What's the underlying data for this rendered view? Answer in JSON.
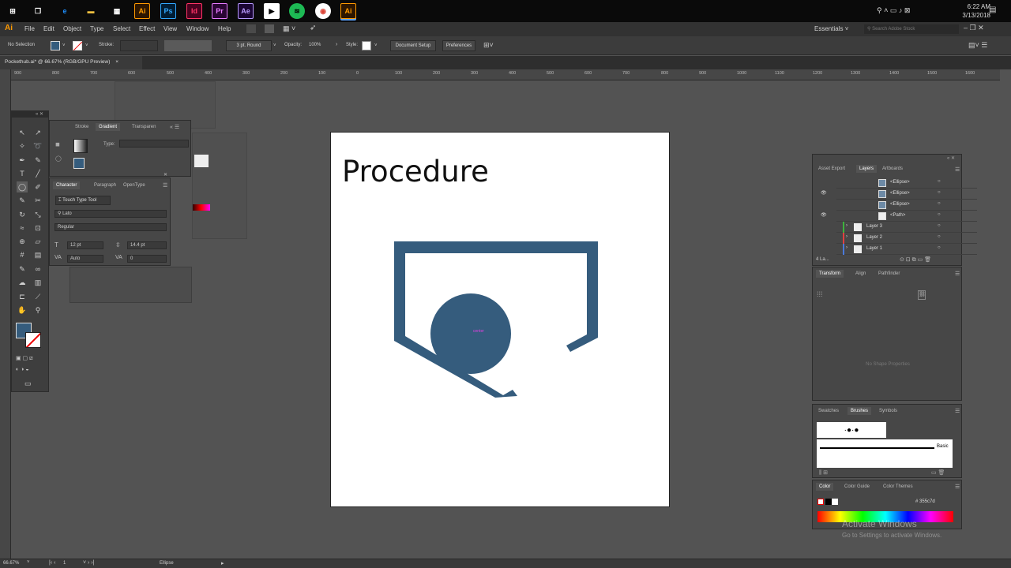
{
  "taskbar": {
    "apps": [
      "Ai",
      "Ps",
      "Id",
      "Pr",
      "Ae",
      "Ai"
    ],
    "time": "6:22 AM",
    "date": "3/13/2018"
  },
  "menu": {
    "logo": "Ai",
    "items": [
      "File",
      "Edit",
      "Object",
      "Type",
      "Select",
      "Effect",
      "View",
      "Window",
      "Help"
    ],
    "workspace": "Essentials",
    "search_placeholder": "Search Adobe Stock"
  },
  "control": {
    "selection": "No Selection",
    "stroke_label": "Stroke:",
    "brush": "3 pt. Round",
    "opacity_label": "Opacity:",
    "opacity_value": "100%",
    "style_label": "Style:",
    "doc_setup": "Document Setup",
    "preferences": "Preferences"
  },
  "document": {
    "tab_title": "Pockethub.ai* @ 66.67% (RGB/GPU Preview)",
    "tab_close": "×"
  },
  "ruler": {
    "labels": [
      "900",
      "800",
      "700",
      "600",
      "500",
      "400",
      "300",
      "200",
      "100",
      "0",
      "100",
      "200",
      "300",
      "400",
      "500",
      "600",
      "700",
      "800",
      "900",
      "1000",
      "1100",
      "1200",
      "1300",
      "1400",
      "1500",
      "1600"
    ]
  },
  "artboard": {
    "title": "Procedure",
    "center_label": "center",
    "fill_color": "#355c7d"
  },
  "gradient_panel": {
    "tabs": [
      "Stroke",
      "Gradient",
      "Transparen"
    ],
    "type_label": "Type:"
  },
  "character_panel": {
    "tabs": [
      "Character",
      "Paragraph",
      "OpenType"
    ],
    "tool_label": "Touch Type Tool",
    "font_family": "Lato",
    "font_style": "Regular",
    "font_size": "12 pt",
    "leading": "14.4 pt",
    "kerning": "Auto",
    "tracking": "0"
  },
  "layers_panel": {
    "tabs": [
      "Asset Export",
      "Layers",
      "Artboards"
    ],
    "rows": [
      "<Ellipse>",
      "<Ellipse>",
      "<Ellipse>",
      "<Path>",
      "Layer 3",
      "Layer 2",
      "Layer 1"
    ],
    "count": "4 La..."
  },
  "transform_panel": {
    "tabs": [
      "Transform",
      "Align",
      "Pathfinder"
    ],
    "message": "No Shape Properties"
  },
  "brushes_panel": {
    "tabs": [
      "Swatches",
      "Brushes",
      "Symbols"
    ],
    "basic_label": "Basic"
  },
  "color_panel": {
    "tabs": [
      "Color",
      "Color Guide",
      "Color Themes"
    ],
    "hex": "355c7d"
  },
  "status": {
    "zoom": "66.67%",
    "artboard_num": "1",
    "tool": "Ellipse"
  },
  "watermark": {
    "title": "Activate Windows",
    "subtitle": "Go to Settings to activate Windows."
  }
}
